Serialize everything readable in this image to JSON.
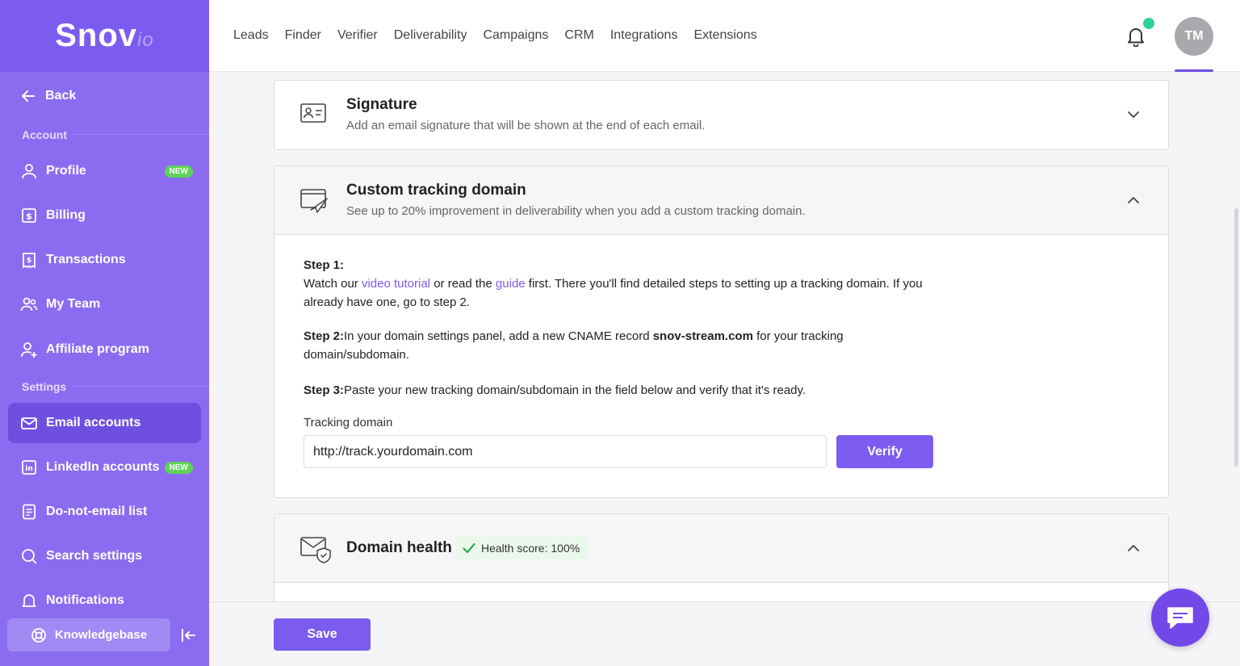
{
  "app": {
    "logo_main": "Snov",
    "logo_suffix": "io"
  },
  "topnav": [
    "Leads",
    "Finder",
    "Verifier",
    "Deliverability",
    "Campaigns",
    "CRM",
    "Integrations",
    "Extensions"
  ],
  "user": {
    "initials": "TM"
  },
  "sidebar": {
    "back_label": "Back",
    "account_label": "Account",
    "settings_label": "Settings",
    "new_badge": "NEW",
    "items": [
      {
        "label": "Profile",
        "icon": "user-icon",
        "badge": "NEW"
      },
      {
        "label": "Billing",
        "icon": "dollar-icon"
      },
      {
        "label": "Transactions",
        "icon": "receipt-icon"
      },
      {
        "label": "My Team",
        "icon": "team-icon"
      },
      {
        "label": "Affiliate program",
        "icon": "user-plus-icon"
      },
      {
        "label": "Email accounts",
        "icon": "mail-icon",
        "active": true
      },
      {
        "label": "LinkedIn accounts",
        "icon": "linkedin-icon",
        "badge": "NEW"
      },
      {
        "label": "Do-not-email list",
        "icon": "list-icon"
      },
      {
        "label": "Search settings",
        "icon": "search-icon"
      },
      {
        "label": "Notifications",
        "icon": "bell-icon"
      }
    ],
    "knowledgebase_label": "Knowledgebase"
  },
  "signature": {
    "title": "Signature",
    "subtitle": "Add an email signature that will be shown at the end of each email."
  },
  "tracking": {
    "title": "Custom tracking domain",
    "subtitle": "See up to 20% improvement in deliverability when you add a custom tracking domain.",
    "step1_label": "Step 1:",
    "step1_pre": "Watch our ",
    "step1_link1": "video tutorial",
    "step1_mid": " or read the ",
    "step1_link2": "guide",
    "step1_post": " first. There you'll find detailed steps to setting up a tracking domain. If you already have one, go to step 2.",
    "step2_label": "Step 2:",
    "step2_pre": "In your domain settings panel, add a new CNAME record ",
    "step2_domain": "snov-stream.com",
    "step2_post": " for your tracking domain/subdomain.",
    "step3_label": "Step 3:",
    "step3_text": "Paste your new tracking domain/subdomain in the field below and verify that it's ready.",
    "field_label": "Tracking domain",
    "field_value": "http://track.yourdomain.com",
    "verify_label": "Verify"
  },
  "health": {
    "title": "Domain health",
    "score_label": "Health score: 100%"
  },
  "footer": {
    "save_label": "Save"
  },
  "colors": {
    "accent": "#7b5cee",
    "sidebar": "#8b6cf0",
    "success": "#2fa84f",
    "badge_new": "#5fd35a"
  }
}
